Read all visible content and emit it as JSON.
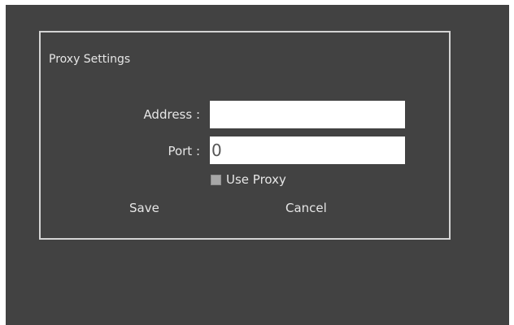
{
  "dialog": {
    "title": "Proxy Settings",
    "address_label": "Address :",
    "address_value": "",
    "port_label": "Port :",
    "port_value": "0",
    "use_proxy_label": "Use Proxy",
    "use_proxy_checked": false,
    "save_label": "Save",
    "cancel_label": "Cancel"
  },
  "colors": {
    "background": "#424242",
    "border": "#d4d4d4",
    "text": "#e6e6e6",
    "input_bg": "#ffffff"
  }
}
